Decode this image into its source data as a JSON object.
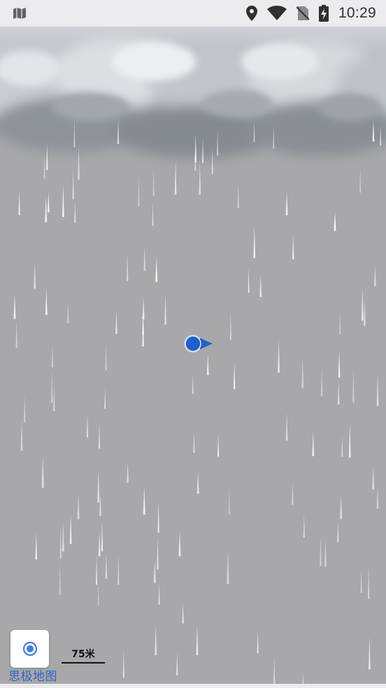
{
  "status_bar": {
    "time": "10:29",
    "icons": [
      "map-icon",
      "location-pin-icon",
      "wifi-icon",
      "no-sim-icon",
      "battery-charging-icon"
    ]
  },
  "map": {
    "weather_overlay": "rain",
    "scale_label": "75米",
    "logo_text": "思极地图",
    "locate_button_icon": "my-location-icon"
  },
  "colors": {
    "map_background": "#a8a8aa",
    "status_bar_background": "#ececee",
    "location_marker": "#1f5fd0",
    "logo": "#2f63c8"
  }
}
